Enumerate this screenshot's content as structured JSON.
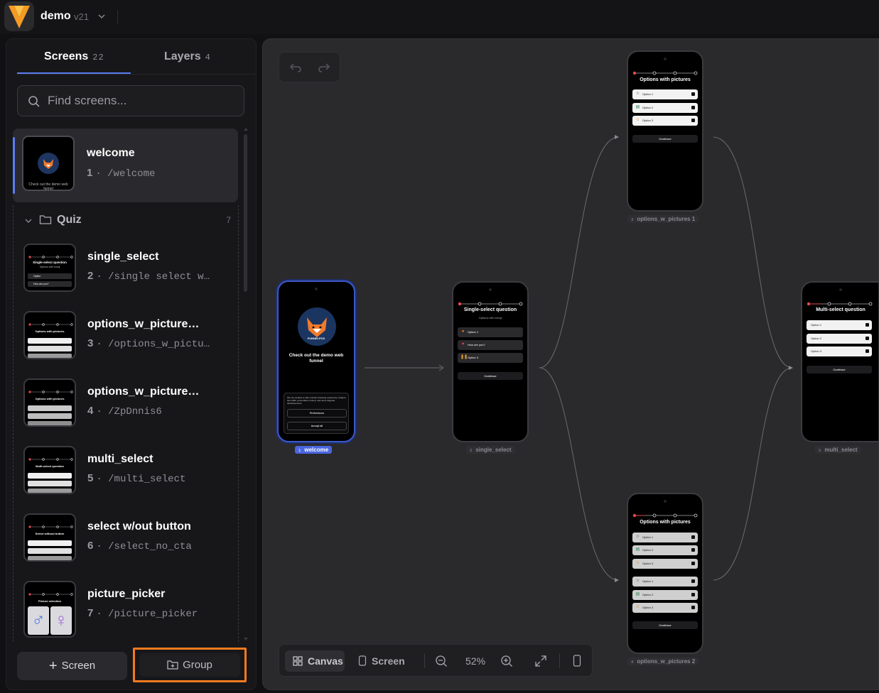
{
  "project": {
    "name": "demo",
    "version": "v21"
  },
  "sidebar": {
    "tabs": [
      {
        "label": "Screens",
        "count": "22"
      },
      {
        "label": "Layers",
        "count": "4"
      }
    ],
    "search": {
      "placeholder": "Find screens..."
    },
    "screens": [
      {
        "title": "welcome",
        "num": "1",
        "path": "/welcome"
      }
    ],
    "group": {
      "name": "Quiz",
      "count": "7",
      "items": [
        {
          "title": "single_select",
          "num": "2",
          "path": "/single select w…"
        },
        {
          "title": "options_w_picture…",
          "num": "3",
          "path": "/options_w_pictu…"
        },
        {
          "title": "options_w_picture…",
          "num": "4",
          "path": "/ZpDnnis6"
        },
        {
          "title": "multi_select",
          "num": "5",
          "path": "/multi_select"
        },
        {
          "title": "select w/out button",
          "num": "6",
          "path": "/select_no_cta"
        },
        {
          "title": "picture_picker",
          "num": "7",
          "path": "/picture_picker"
        }
      ]
    },
    "buttons": {
      "screen": "Screen",
      "group": "Group"
    }
  },
  "canvas": {
    "zoom": "52%",
    "toolbar": {
      "canvas": "Canvas",
      "screen": "Screen"
    },
    "nodes": {
      "welcome": {
        "brand": "FUNNELFOX",
        "heading": "Check out the demo web funnel",
        "cookie": "We use cookies to offer a better browsing experience, analyze site traffic, personalize content, and serve targeted advertisements.",
        "prefs": "Preferences",
        "accept": "Accept all",
        "label_num": "1",
        "label": "welcome"
      },
      "single_select": {
        "title": "Single-select question",
        "sub": "Options with emoji",
        "options": [
          "Option 1",
          "How are you?",
          "Option 3"
        ],
        "continue": "Continue",
        "label_num": "2",
        "label": "single_select"
      },
      "pictures1": {
        "title": "Options with pictures",
        "options": [
          "Option 1",
          "Option 2",
          "Option 3"
        ],
        "continue": "Continue",
        "label_num": "3",
        "label": "options_w_pictures 1"
      },
      "pictures2": {
        "title": "Options with pictures",
        "options": [
          "Option 1",
          "Option 2",
          "Option 3",
          "Option 1",
          "Option 2",
          "Option 3"
        ],
        "continue": "Continue",
        "label_num": "4",
        "label": "options_w_pictures 2"
      },
      "multi_select": {
        "title": "Multi-select question",
        "options": [
          "Option 1",
          "Option 2",
          "Option 3"
        ],
        "continue": "Continue",
        "label_num": "5",
        "label": "multi_select"
      }
    },
    "thumbs": {
      "welcome_text": "Check out the demo web funnel",
      "single_title": "Single-select question",
      "single_sub": "Options with emoji",
      "single_opts": [
        "Option",
        "How are you?"
      ],
      "pictures_title": "Options with pictures",
      "multi_title": "Multi-select question",
      "nobtn_title": "Select without button",
      "picker_title": "Picture selection"
    }
  },
  "colors": {
    "accent": "#5b7cf2",
    "highlight": "#f47a1f",
    "progress": "#e5484d"
  }
}
